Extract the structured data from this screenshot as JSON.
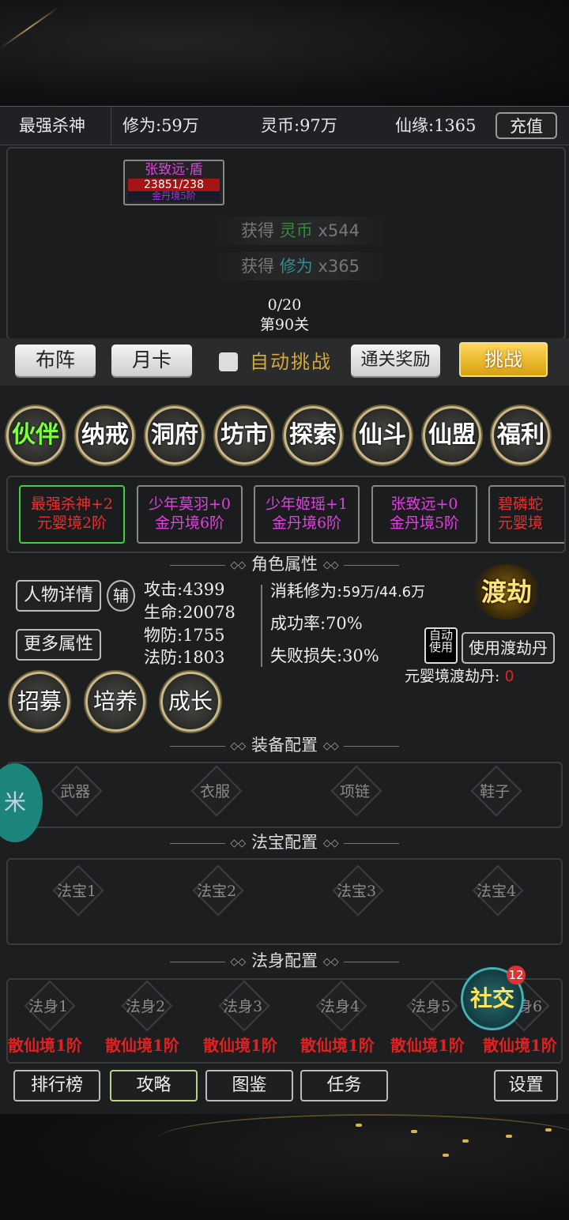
{
  "header": {
    "player_name": "最强杀神",
    "cultivation": "修为:59万",
    "spirit_coin": "灵币:97万",
    "fate": "仙缘:1365",
    "recharge_label": "充值"
  },
  "battle": {
    "enemy_name": "张致远·盾",
    "enemy_hp": "23851/238",
    "enemy_level": "金丹境5阶",
    "gain1": {
      "prefix": "获得",
      "item": "灵币",
      "qty": "x544"
    },
    "gain2": {
      "prefix": "获得",
      "item": "修为",
      "qty": "x365"
    },
    "progress": "0/20",
    "stage": "第90关"
  },
  "actions": {
    "formation": "布阵",
    "monthly_card": "月卡",
    "auto_challenge": "自动挑战",
    "clear_reward": "通关奖励",
    "challenge": "挑战"
  },
  "menu": [
    {
      "label": "伙伴"
    },
    {
      "label": "纳戒"
    },
    {
      "label": "洞府"
    },
    {
      "label": "坊市"
    },
    {
      "label": "探索"
    },
    {
      "label": "仙斗"
    },
    {
      "label": "仙盟"
    },
    {
      "label": "福利"
    }
  ],
  "partners": [
    {
      "name": "最强杀神+2",
      "realm": "元婴境2阶"
    },
    {
      "name": "少年莫羽+0",
      "realm": "金丹境6阶"
    },
    {
      "name": "少年姬瑶+1",
      "realm": "金丹境6阶"
    },
    {
      "name": "张致远+0",
      "realm": "金丹境5阶"
    },
    {
      "name": "碧磷蛇",
      "realm": "元婴境"
    }
  ],
  "attributes": {
    "title": "角色属性",
    "detail_button": "人物详情",
    "assist_button": "辅",
    "more_button": "更多属性",
    "attack": "攻击:4399",
    "hp": "生命:20078",
    "pdef": "物防:1755",
    "mdef": "法防:1803",
    "cost_label": "消耗修为:",
    "cost_value": "59万/44.6万",
    "success": "成功率:70%",
    "failure": "失败损失:30%",
    "tribulation": "渡劫",
    "auto_use": "自动使用",
    "use_pill_button": "使用渡劫丹",
    "pill_label": "元婴境渡劫丹:",
    "pill_count": "0",
    "recruit": "招募",
    "train": "培养",
    "grow": "成长"
  },
  "equipment": {
    "title": "装备配置",
    "slots": [
      "武器",
      "衣服",
      "项链",
      "鞋子"
    ]
  },
  "treasure": {
    "title": "法宝配置",
    "slots": [
      "法宝1",
      "法宝2",
      "法宝3",
      "法宝4"
    ]
  },
  "body": {
    "title": "法身配置",
    "slots": [
      "法身1",
      "法身2",
      "法身3",
      "法身4",
      "法身5",
      "法身6"
    ],
    "realms": [
      "散仙境1阶",
      "散仙境1阶",
      "散仙境1阶",
      "散仙境1阶",
      "散仙境1阶",
      "散仙境1阶"
    ]
  },
  "social": {
    "label": "社交",
    "badge": "12"
  },
  "float_icon": "米",
  "bottom": {
    "rank": "排行榜",
    "guide": "攻略",
    "atlas": "图鉴",
    "task": "任务",
    "settings": "设置"
  },
  "colors": {
    "accent_gold": "#d4a93a",
    "partner_name": "#e040e0",
    "realm_red": "#e32020",
    "selected_green": "#3bd43b"
  }
}
